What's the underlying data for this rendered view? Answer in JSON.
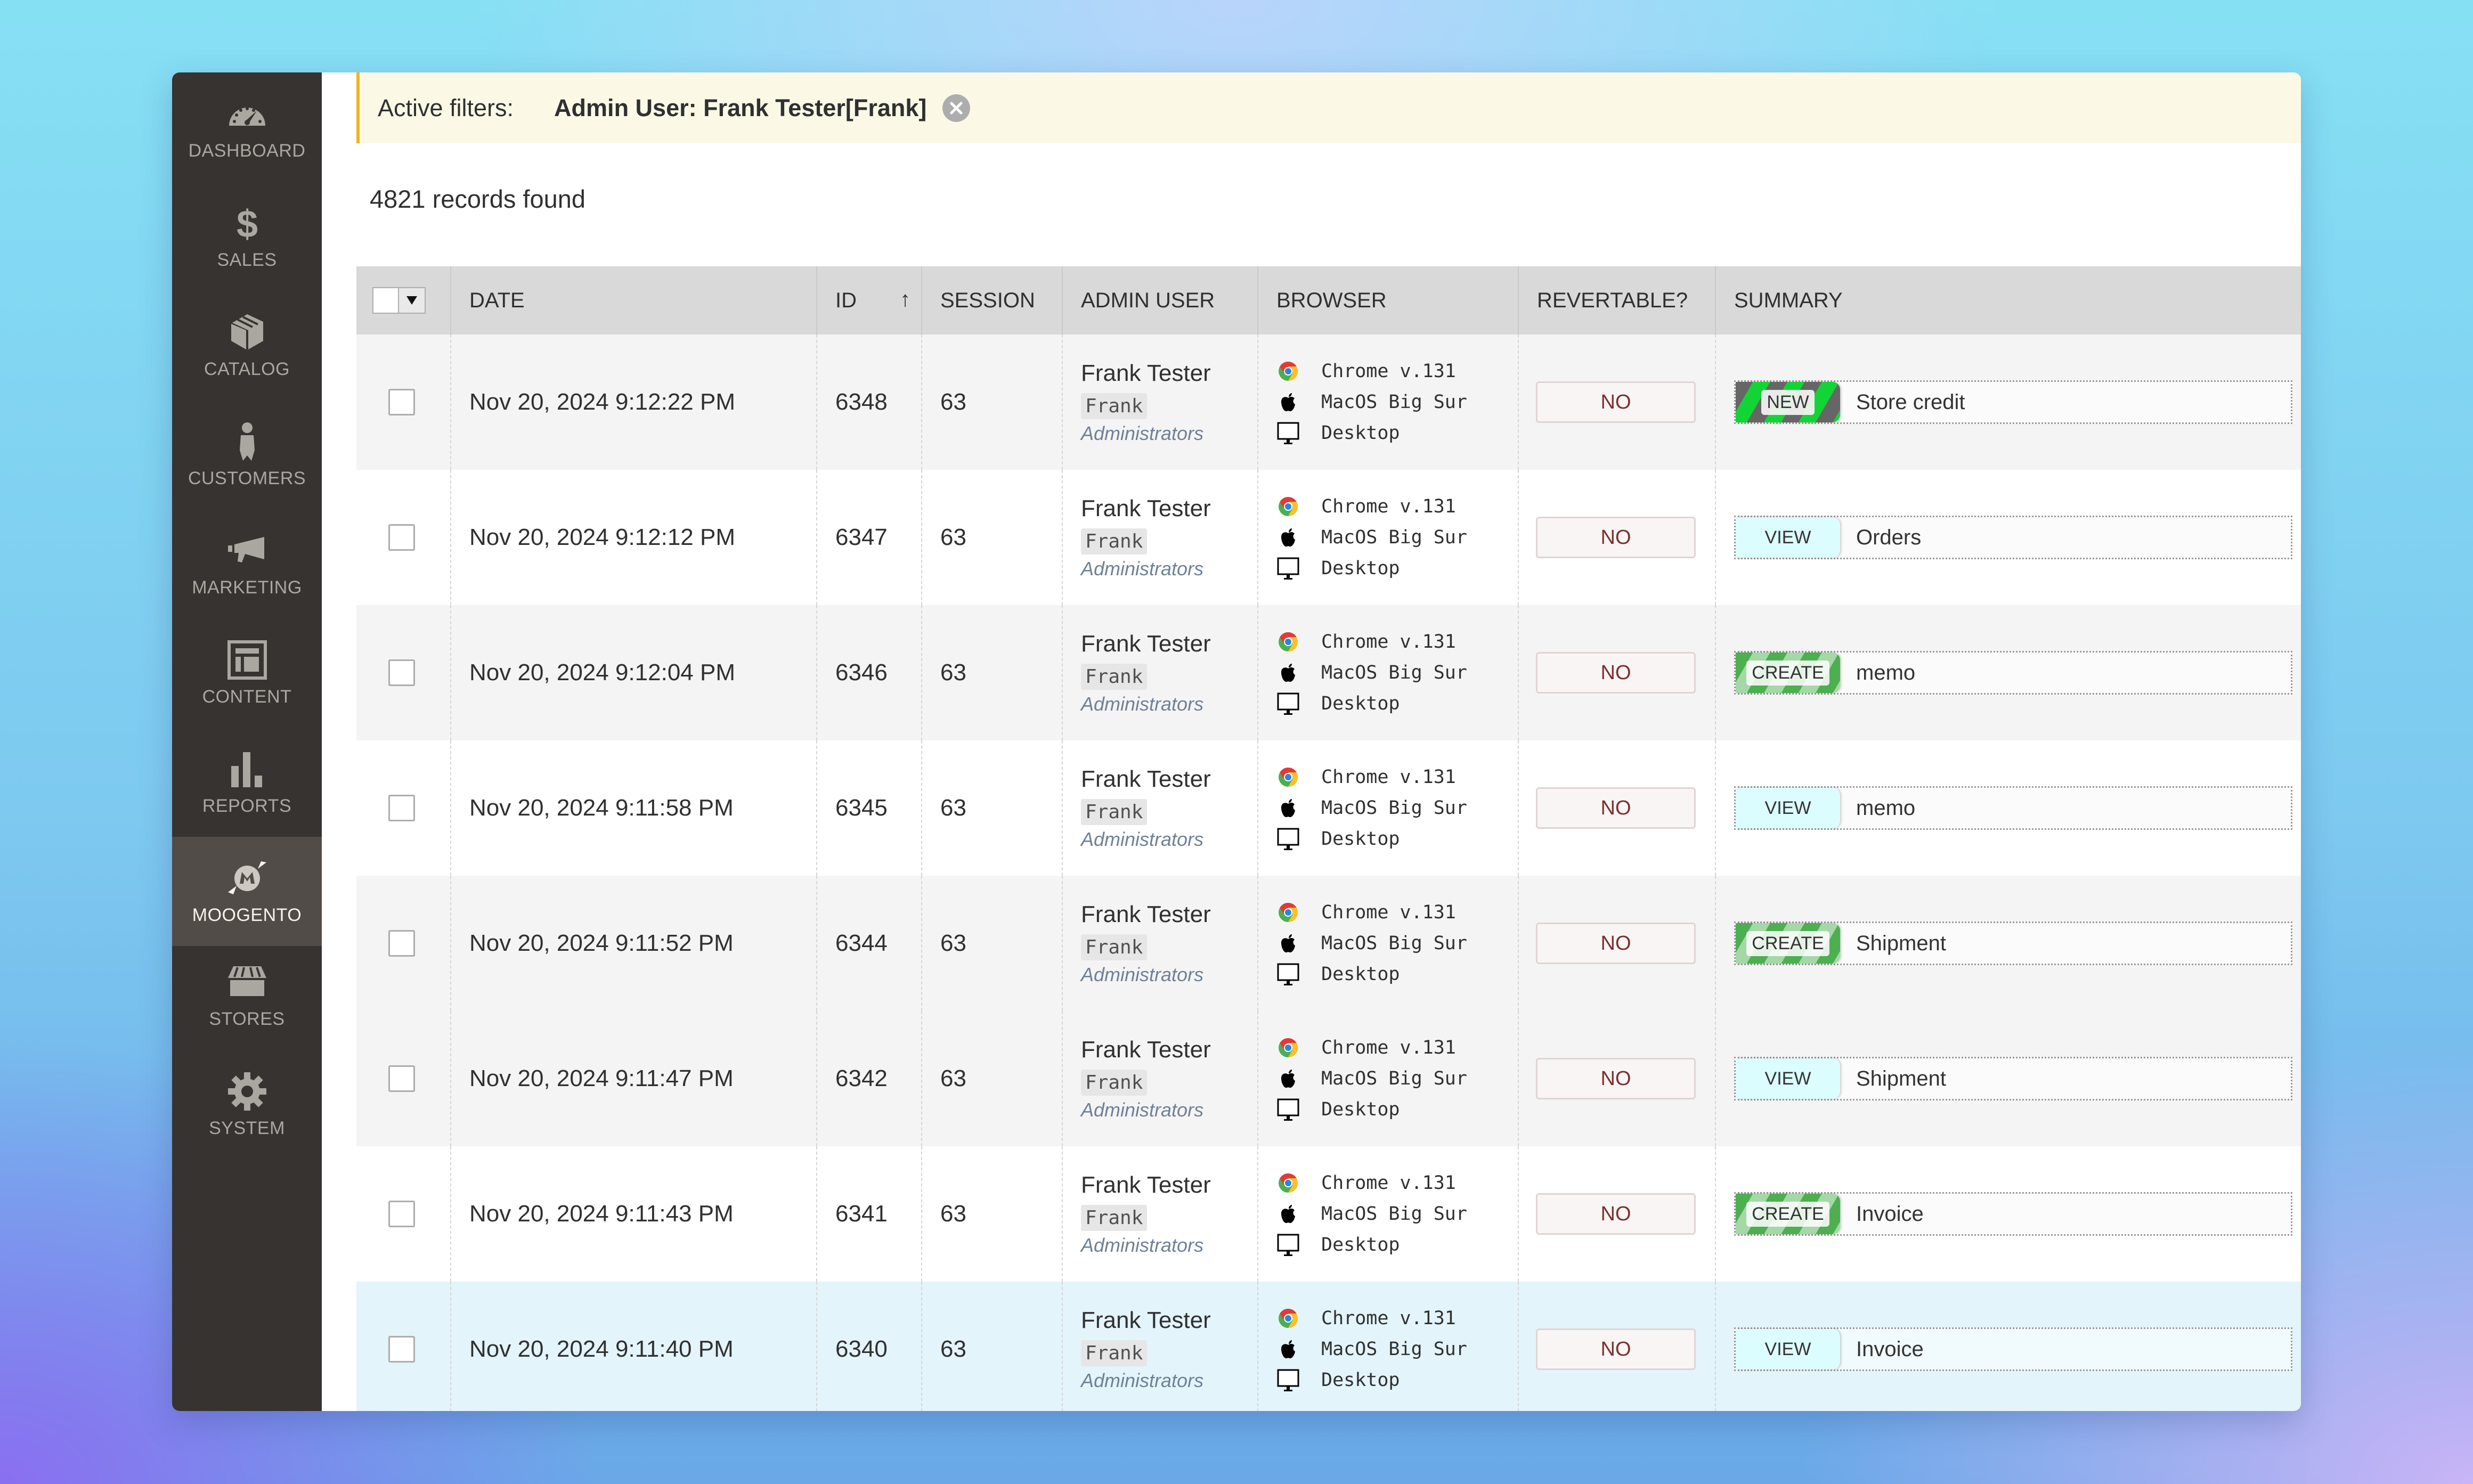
{
  "sidebar": {
    "items": [
      {
        "label": "Dashboard",
        "icon": "dashboard-icon",
        "active": false
      },
      {
        "label": "Sales",
        "icon": "dollar-icon",
        "active": false
      },
      {
        "label": "Catalog",
        "icon": "box-icon",
        "active": false
      },
      {
        "label": "Customers",
        "icon": "person-icon",
        "active": false
      },
      {
        "label": "Marketing",
        "icon": "megaphone-icon",
        "active": false
      },
      {
        "label": "Content",
        "icon": "layout-icon",
        "active": false
      },
      {
        "label": "Reports",
        "icon": "bar-chart-icon",
        "active": false
      },
      {
        "label": "Moogento",
        "icon": "moogento-logo-icon",
        "active": true
      },
      {
        "label": "Stores",
        "icon": "storefront-icon",
        "active": false
      },
      {
        "label": "System",
        "icon": "gear-icon",
        "active": false
      }
    ]
  },
  "filters": {
    "title": "Active filters:",
    "value": "Admin User: Frank Tester[Frank]",
    "remove_icon": "close-circle-icon"
  },
  "records_found": "4821 records found",
  "grid": {
    "columns": [
      "DATE",
      "ID",
      "SESSION",
      "ADMIN USER",
      "BROWSER",
      "REVERTABLE?",
      "SUMMARY"
    ],
    "sort": {
      "column": "ID",
      "direction": "asc",
      "icon": "arrow-up-icon"
    },
    "mass_select_icon": "caret-down-icon",
    "rows": [
      {
        "date": "Nov 20, 2024 9:12:22 PM",
        "id": "6348",
        "session": "63",
        "admin_name": "Frank Tester",
        "admin_user": "Frank",
        "admin_role": "Administrators",
        "browser": "Chrome v.131",
        "os": "MacOS Big Sur",
        "device": "Desktop",
        "revertable": "NO",
        "action": "NEW",
        "action_type": "new",
        "summary": "Store credit",
        "style": "gray"
      },
      {
        "date": "Nov 20, 2024 9:12:12 PM",
        "id": "6347",
        "session": "63",
        "admin_name": "Frank Tester",
        "admin_user": "Frank",
        "admin_role": "Administrators",
        "browser": "Chrome v.131",
        "os": "MacOS Big Sur",
        "device": "Desktop",
        "revertable": "NO",
        "action": "VIEW",
        "action_type": "view",
        "summary": "Orders",
        "style": "white"
      },
      {
        "date": "Nov 20, 2024 9:12:04 PM",
        "id": "6346",
        "session": "63",
        "admin_name": "Frank Tester",
        "admin_user": "Frank",
        "admin_role": "Administrators",
        "browser": "Chrome v.131",
        "os": "MacOS Big Sur",
        "device": "Desktop",
        "revertable": "NO",
        "action": "CREATE",
        "action_type": "create",
        "summary": "memo",
        "style": "gray"
      },
      {
        "date": "Nov 20, 2024 9:11:58 PM",
        "id": "6345",
        "session": "63",
        "admin_name": "Frank Tester",
        "admin_user": "Frank",
        "admin_role": "Administrators",
        "browser": "Chrome v.131",
        "os": "MacOS Big Sur",
        "device": "Desktop",
        "revertable": "NO",
        "action": "VIEW",
        "action_type": "view",
        "summary": "memo",
        "style": "white"
      },
      {
        "date": "Nov 20, 2024 9:11:52 PM",
        "id": "6344",
        "session": "63",
        "admin_name": "Frank Tester",
        "admin_user": "Frank",
        "admin_role": "Administrators",
        "browser": "Chrome v.131",
        "os": "MacOS Big Sur",
        "device": "Desktop",
        "revertable": "NO",
        "action": "CREATE",
        "action_type": "create",
        "summary": "Shipment",
        "style": "gray"
      },
      {
        "date": "Nov 20, 2024 9:11:47 PM",
        "id": "6342",
        "session": "63",
        "admin_name": "Frank Tester",
        "admin_user": "Frank",
        "admin_role": "Administrators",
        "browser": "Chrome v.131",
        "os": "MacOS Big Sur",
        "device": "Desktop",
        "revertable": "NO",
        "action": "VIEW",
        "action_type": "view",
        "summary": "Shipment",
        "style": "gray"
      },
      {
        "date": "Nov 20, 2024 9:11:43 PM",
        "id": "6341",
        "session": "63",
        "admin_name": "Frank Tester",
        "admin_user": "Frank",
        "admin_role": "Administrators",
        "browser": "Chrome v.131",
        "os": "MacOS Big Sur",
        "device": "Desktop",
        "revertable": "NO",
        "action": "CREATE",
        "action_type": "create",
        "summary": "Invoice",
        "style": "white"
      },
      {
        "date": "Nov 20, 2024 9:11:40 PM",
        "id": "6340",
        "session": "63",
        "admin_name": "Frank Tester",
        "admin_user": "Frank",
        "admin_role": "Administrators",
        "browser": "Chrome v.131",
        "os": "MacOS Big Sur",
        "device": "Desktop",
        "revertable": "NO",
        "action": "VIEW",
        "action_type": "view",
        "summary": "Invoice",
        "style": "hover"
      }
    ]
  },
  "colors": {
    "sidebar_bg": "#373330",
    "sidebar_active_bg": "#514c48",
    "filter_bg": "#fbf9e6",
    "filter_accent": "#f3b220",
    "header_bg": "#d9d9d9",
    "row_gray": "#f4f4f4",
    "row_hover": "#e3f4fb",
    "revert_text": "#7a2f2f",
    "view_tag": "#dcfdfe",
    "create_tag": "#4caf50",
    "new_tag": "#12d535"
  }
}
